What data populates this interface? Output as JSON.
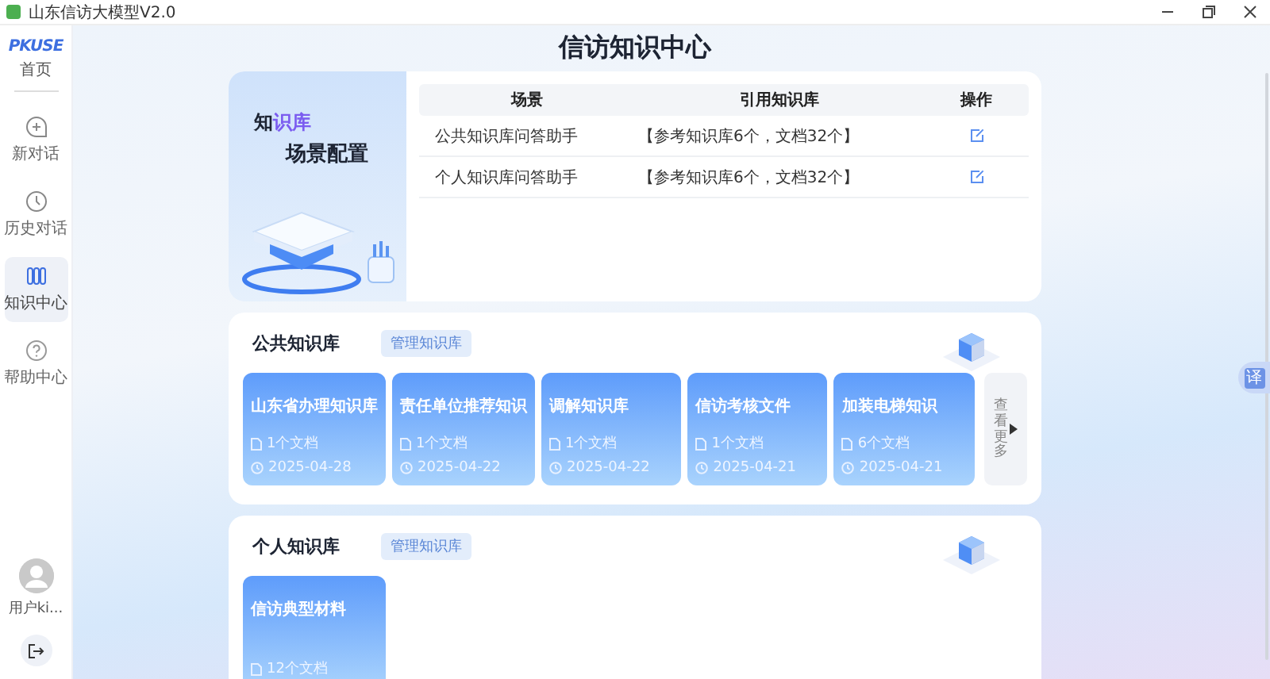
{
  "window": {
    "title": "山东信访大模型V2.0"
  },
  "sidebar": {
    "logo": "PKUSE",
    "home_label": "首页",
    "items": [
      {
        "label": "新对话",
        "kind": "new",
        "selected": false
      },
      {
        "label": "历史对话",
        "kind": "history",
        "selected": false
      },
      {
        "label": "知识中心",
        "kind": "knowledge",
        "selected": true
      },
      {
        "label": "帮助中心",
        "kind": "help",
        "selected": false
      }
    ],
    "user": "用户ki..."
  },
  "page_title": "信访知识中心",
  "scene_config": {
    "banner": {
      "title_parts": [
        {
          "text": "知",
          "accent": false
        },
        {
          "text": "识库",
          "accent": true
        }
      ],
      "subtitle": "场景配置"
    },
    "columns": [
      "场景",
      "引用知识库",
      "操作"
    ],
    "rows": [
      {
        "scene": "公共知识库问答助手",
        "reference": "【参考知识库6个，文档32个】"
      },
      {
        "scene": "个人知识库问答助手",
        "reference": "【参考知识库6个，文档32个】"
      }
    ]
  },
  "sections": [
    {
      "title": "公共知识库",
      "manage_button": "管理知识库",
      "more": "查看更多",
      "cards": [
        {
          "name": "山东省办理知识库",
          "docs": "1个文档",
          "date": "2025-04-28"
        },
        {
          "name": "责任单位推荐知识",
          "docs": "1个文档",
          "date": "2025-04-22"
        },
        {
          "name": "调解知识库",
          "docs": "1个文档",
          "date": "2025-04-22"
        },
        {
          "name": "信访考核文件",
          "docs": "1个文档",
          "date": "2025-04-21"
        },
        {
          "name": "加装电梯知识",
          "docs": "6个文档",
          "date": "2025-04-21"
        }
      ]
    },
    {
      "title": "个人知识库",
      "manage_button": "管理知识库",
      "cards": [
        {
          "name": "信访典型材料",
          "docs": "12个文档"
        }
      ]
    }
  ],
  "translate_button": "译"
}
